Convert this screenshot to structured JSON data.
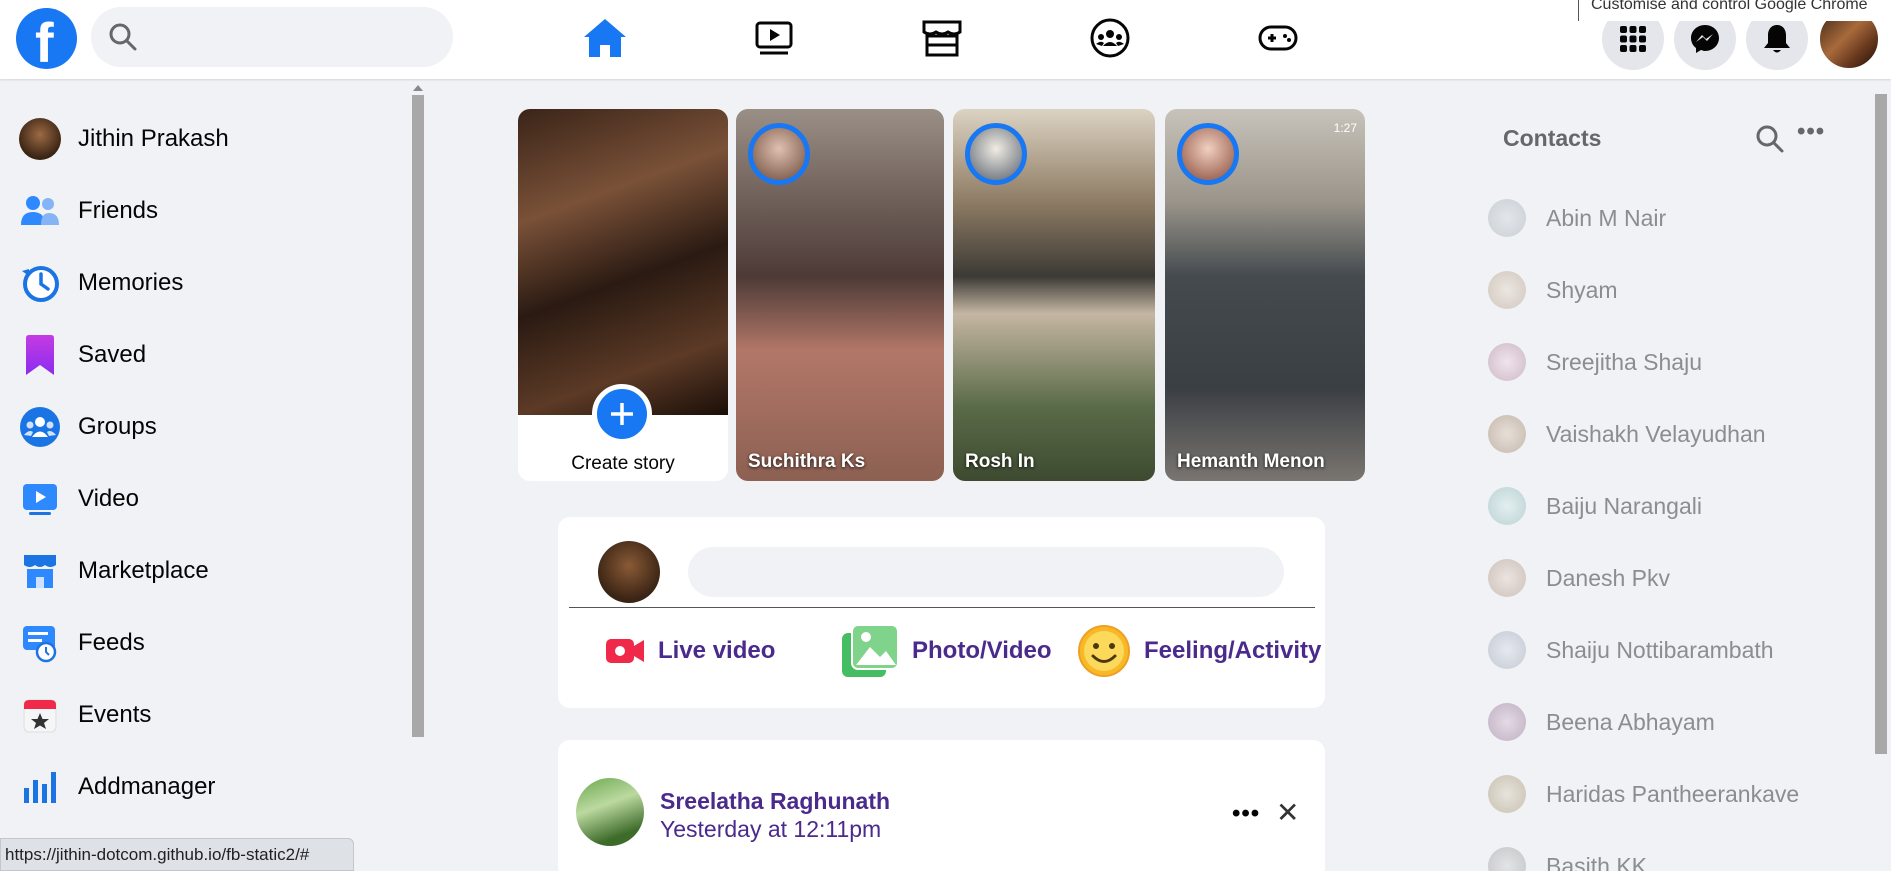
{
  "browser": {
    "tooltip": "Customise and control Google Chrome",
    "status_url": "https://jithin-dotcom.github.io/fb-static2/#"
  },
  "header": {
    "logo_letter": "f",
    "search": {
      "placeholder": "",
      "value": ""
    },
    "nav_icons": [
      "home-icon",
      "watch-icon",
      "marketplace-icon",
      "groups-icon",
      "gaming-icon"
    ],
    "right_icons": [
      "menu-grid-icon",
      "messenger-icon",
      "notifications-icon"
    ],
    "accent_color": "#1877f2"
  },
  "sidebar": {
    "items": [
      {
        "label": "Jithin Prakash",
        "icon": "profile-avatar"
      },
      {
        "label": "Friends",
        "icon": "friends-icon"
      },
      {
        "label": "Memories",
        "icon": "memories-icon"
      },
      {
        "label": "Saved",
        "icon": "saved-icon"
      },
      {
        "label": "Groups",
        "icon": "groups-icon"
      },
      {
        "label": "Video",
        "icon": "video-icon"
      },
      {
        "label": "Marketplace",
        "icon": "marketplace-icon"
      },
      {
        "label": "Feeds",
        "icon": "feeds-icon"
      },
      {
        "label": "Events",
        "icon": "events-icon"
      },
      {
        "label": "Addmanager",
        "icon": "ads-manager-icon"
      }
    ]
  },
  "stories": {
    "create_label": "Create story",
    "items": [
      {
        "name": "Suchithra Ks"
      },
      {
        "name": "Rosh In"
      },
      {
        "name": "Hemanth Menon",
        "time": "1:27"
      }
    ]
  },
  "composer": {
    "placeholder": "",
    "actions": [
      {
        "label": "Live video",
        "icon": "live-video-icon"
      },
      {
        "label": "Photo/Video",
        "icon": "photo-video-icon"
      },
      {
        "label": "Feeling/Activity",
        "icon": "feeling-icon"
      }
    ]
  },
  "post": {
    "author": "Sreelatha Raghunath",
    "time": "Yesterday at 12:11pm",
    "more_label": "•••",
    "close_label": "✕"
  },
  "contacts": {
    "title": "Contacts",
    "more_label": "•••",
    "items": [
      "Abin M Nair",
      "Shyam",
      "Sreejitha Shaju",
      "Vaishakh Velayudhan",
      "Baiju Narangali",
      "Danesh Pkv",
      "Shaiju Nottibarambath",
      "Beena Abhayam",
      "Haridas Pantheerankave",
      "Basith KK"
    ]
  }
}
